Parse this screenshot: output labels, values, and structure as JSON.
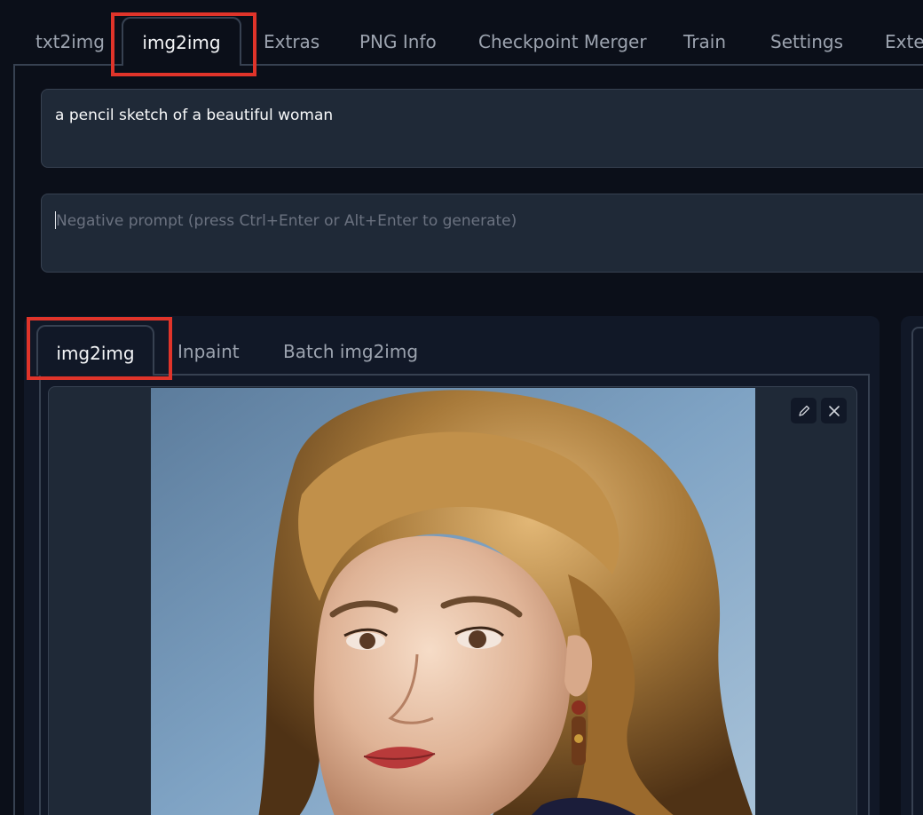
{
  "top_tabs": [
    "txt2img",
    "img2img",
    "Extras",
    "PNG Info",
    "Checkpoint Merger",
    "Train",
    "Settings",
    "Exter"
  ],
  "active_top_tab": "img2img",
  "prompt": {
    "value": "a pencil sketch of a beautiful woman"
  },
  "negative_prompt": {
    "placeholder": "Negative prompt (press Ctrl+Enter or Alt+Enter to generate)"
  },
  "sub_tabs": [
    "img2img",
    "Inpaint",
    "Batch img2img"
  ],
  "active_sub_tab": "img2img",
  "image_buttons": {
    "edit_icon": "pencil-icon",
    "clear_icon": "close-icon"
  },
  "colors": {
    "background": "#0b0f19",
    "panel": "#111827",
    "input": "#1f2937",
    "border": "#374151",
    "highlight": "#e0342a"
  }
}
